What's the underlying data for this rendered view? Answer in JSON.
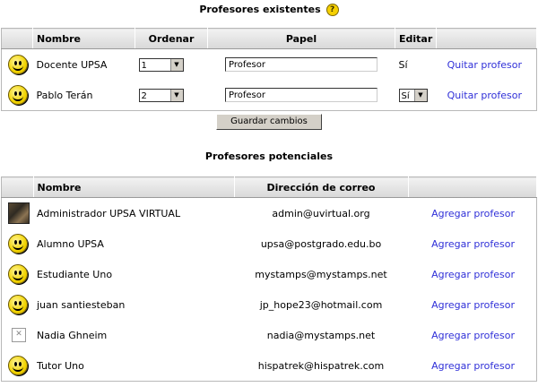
{
  "existing": {
    "title": "Profesores existentes",
    "help_icon": "?",
    "columns": [
      "Nombre",
      "Ordenar",
      "Papel",
      "Editar"
    ],
    "rows": [
      {
        "avatar": "smiley-icon",
        "name": "Docente UPSA",
        "order": "1",
        "role": "Profesor",
        "edit": "Sí",
        "edit_is_select": false,
        "action": "Quitar profesor"
      },
      {
        "avatar": "smiley-icon",
        "name": "Pablo Terán",
        "order": "2",
        "role": "Profesor",
        "edit": "Sí",
        "edit_is_select": true,
        "action": "Quitar profesor"
      }
    ],
    "save_button": "Guardar cambios"
  },
  "potential": {
    "title": "Profesores potenciales",
    "columns": [
      "Nombre",
      "Dirección de correo"
    ],
    "rows": [
      {
        "avatar": "photo",
        "name": "Administrador UPSA VIRTUAL",
        "email": "admin@uvirtual.org",
        "action": "Agregar profesor"
      },
      {
        "avatar": "smiley-icon",
        "name": "Alumno UPSA",
        "email": "upsa@postgrado.edu.bo",
        "action": "Agregar profesor"
      },
      {
        "avatar": "smiley-icon",
        "name": "Estudiante Uno",
        "email": "mystamps@mystamps.net",
        "action": "Agregar profesor"
      },
      {
        "avatar": "smiley-icon",
        "name": "juan santiesteban",
        "email": "jp_hope23@hotmail.com",
        "action": "Agregar profesor"
      },
      {
        "avatar": "broken-image-icon",
        "name": "Nadia Ghneim",
        "email": "nadia@mystamps.net",
        "action": "Agregar profesor"
      },
      {
        "avatar": "smiley-icon",
        "name": "Tutor Uno",
        "email": "hispatrek@hispatrek.com",
        "action": "Agregar profesor"
      }
    ]
  },
  "colors": {
    "link": "#3030d8",
    "header_bg": "#d8d8d8",
    "button_bg": "#d4d0c8"
  }
}
